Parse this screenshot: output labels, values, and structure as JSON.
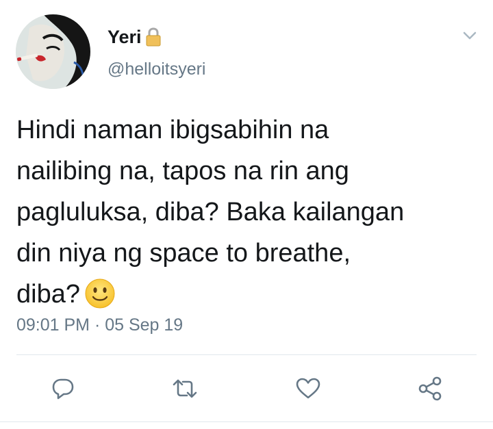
{
  "user": {
    "display_name": "Yeri",
    "handle": "@helloitsyeri",
    "protected_icon": "lock-icon",
    "avatar_icon": "avatar-illustration"
  },
  "tweet": {
    "text": "Hindi naman ibigsabihin na\nnailibing na, tapos na rin ang\npagluluksa, diba? Baka kailangan\ndin niya ng space to breathe,\ndiba?",
    "emoji": "slightly-smiling-face",
    "timestamp": "09:01 PM · 05 Sep 19"
  },
  "actions": {
    "reply_icon": "reply-icon",
    "retweet_icon": "retweet-icon",
    "like_icon": "heart-icon",
    "share_icon": "share-icon"
  },
  "colors": {
    "text": "#14171a",
    "secondary": "#657786",
    "divider": "#e1e8ed",
    "icon": "#657786"
  }
}
